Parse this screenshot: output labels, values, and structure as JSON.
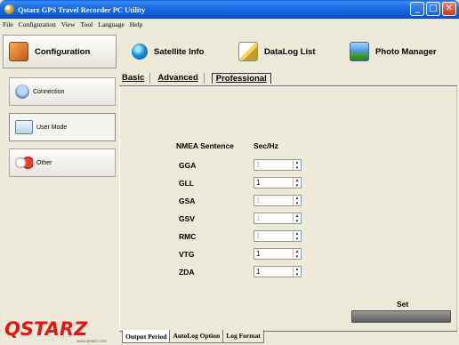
{
  "window": {
    "title": "Qstarz GPS Travel Recorder PC Utility",
    "minimize_glyph": "_",
    "maximize_glyph": "□",
    "close_glyph": "✕"
  },
  "menu": [
    "File",
    "Configuration",
    "View",
    "Tool",
    "Language",
    "Help"
  ],
  "toolbar": {
    "configuration": "Configuration",
    "satellite_info": "Satellite Info",
    "datalog_list": "DataLog List",
    "photo_manager": "Photo Manager"
  },
  "sidebar": {
    "connection": "Connection",
    "user_mode": "User Mode",
    "other": "Other"
  },
  "logo": {
    "text": "QSTARZ",
    "url_text": "www.Qstarz.com"
  },
  "tabs_top": {
    "basic": "Basic",
    "advanced": "Advanced",
    "professional": "Professional",
    "active": "Professional"
  },
  "nmea": {
    "header_sentence": "NMEA Sentence",
    "header_rate": "Sec/Hz",
    "rows": [
      {
        "label": "GGA",
        "value": "1",
        "enabled": false
      },
      {
        "label": "GLL",
        "value": "1",
        "enabled": true
      },
      {
        "label": "GSA",
        "value": "1",
        "enabled": false
      },
      {
        "label": "GSV",
        "value": "1",
        "enabled": false
      },
      {
        "label": "RMC",
        "value": "1",
        "enabled": false
      },
      {
        "label": "VTG",
        "value": "1",
        "enabled": true
      },
      {
        "label": "ZDA",
        "value": "1",
        "enabled": true
      }
    ],
    "up_arrow": "▲",
    "down_arrow": "▼"
  },
  "set": {
    "label": "Set",
    "button_label": ""
  },
  "tabs_bottom": {
    "output_period": "Output Period",
    "autolog_option": "AutoLog Option",
    "log_format": "Log Format",
    "active": "Output Period"
  }
}
